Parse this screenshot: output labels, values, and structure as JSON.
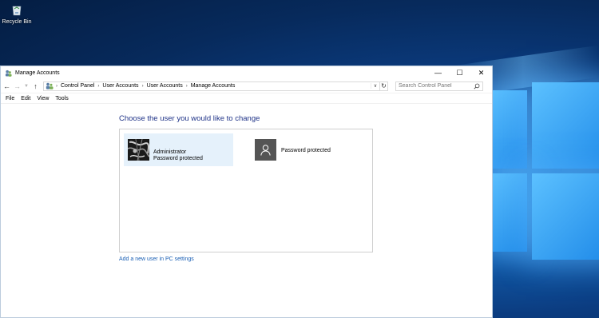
{
  "desktop": {
    "recycle_bin_label": "Recycle Bin"
  },
  "window": {
    "title": "Manage Accounts",
    "controls": {
      "minimize": "—",
      "maximize": "☐",
      "close": "✕"
    }
  },
  "address_bar": {
    "breadcrumbs": [
      "Control Panel",
      "User Accounts",
      "User Accounts",
      "Manage Accounts"
    ],
    "separator": "›",
    "search_placeholder": "Search Control Panel"
  },
  "menu": {
    "items": [
      "File",
      "Edit",
      "View",
      "Tools"
    ]
  },
  "main": {
    "heading": "Choose the user you would like to change",
    "accounts": [
      {
        "name": "Administrator",
        "status": "Password protected",
        "selected": true
      },
      {
        "name": "",
        "status": "Password protected",
        "selected": false
      }
    ],
    "add_user_link": "Add a new user in PC settings"
  },
  "colors": {
    "heading": "#1e3287",
    "link": "#1a5fb4",
    "selected_tile": "#e5f1fb",
    "desktop_accent": "#1f8ae8"
  },
  "icons": {
    "back": "arrow-left-icon",
    "forward": "arrow-right-icon",
    "recent": "chevron-down-icon",
    "up": "arrow-up-icon",
    "refresh": "refresh-icon",
    "search": "search-icon",
    "user": "user-silhouette-icon"
  }
}
